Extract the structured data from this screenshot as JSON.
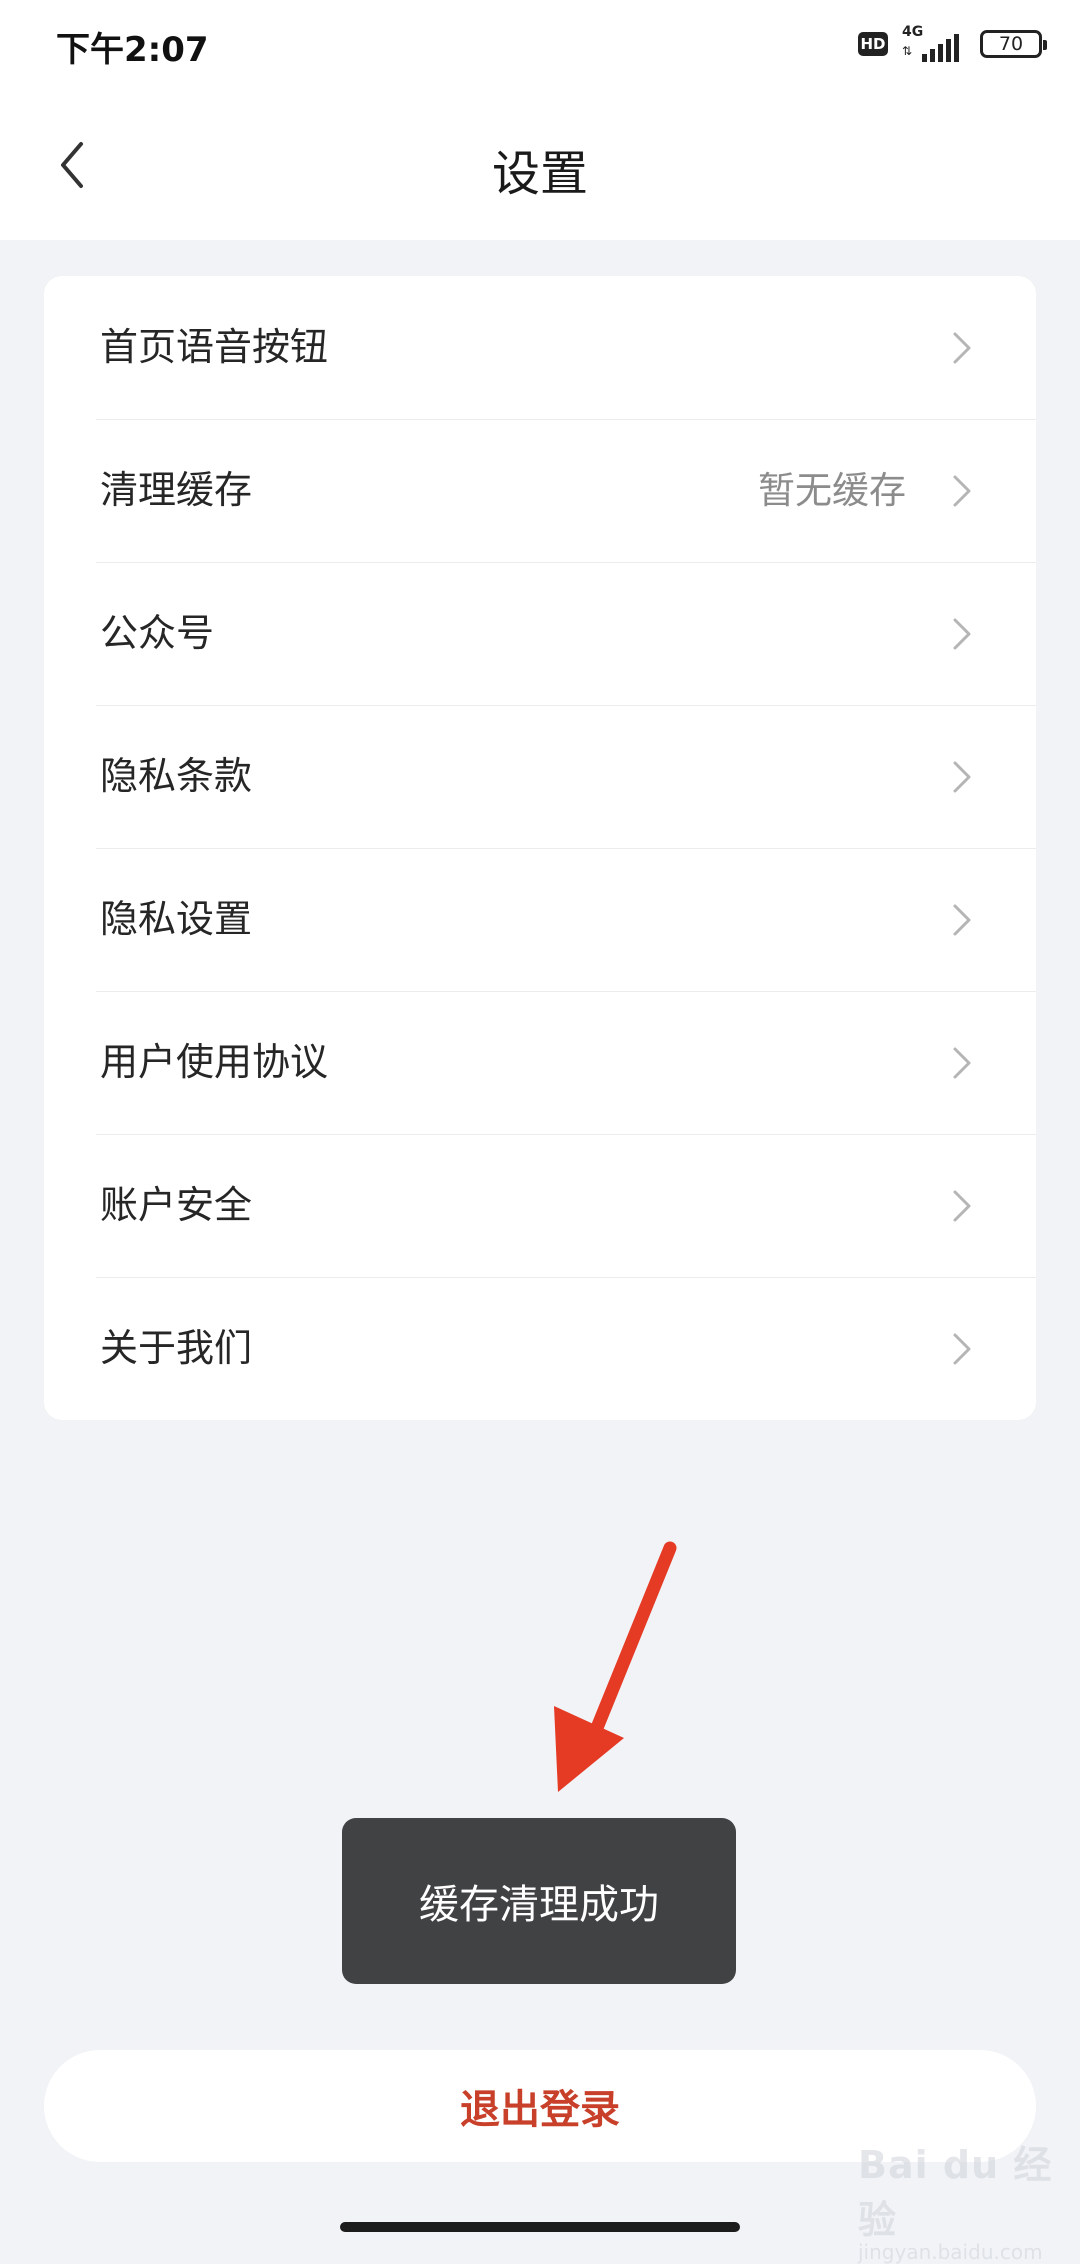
{
  "status_bar": {
    "time": "下午2:07",
    "hd_label": "HD",
    "network_label": "4G",
    "network_arrows": "⇅",
    "battery": "70"
  },
  "nav": {
    "title": "设置",
    "back_icon": "chevron-left-icon"
  },
  "settings": {
    "items": [
      {
        "label": "首页语音按钮",
        "value": ""
      },
      {
        "label": "清理缓存",
        "value": "暂无缓存"
      },
      {
        "label": "公众号",
        "value": ""
      },
      {
        "label": "隐私条款",
        "value": ""
      },
      {
        "label": "隐私设置",
        "value": ""
      },
      {
        "label": "用户使用协议",
        "value": ""
      },
      {
        "label": "账户安全",
        "value": ""
      },
      {
        "label": "关于我们",
        "value": ""
      }
    ],
    "chevron_icon": "chevron-right-icon"
  },
  "toast": {
    "message": "缓存清理成功"
  },
  "logout": {
    "label": "退出登录"
  },
  "watermark": {
    "main": "Bai du 经验",
    "sub": "jingyan.baidu.com"
  },
  "colors": {
    "background": "#f1f3f7",
    "logout_text": "#c8402a",
    "toast_bg": "#404244",
    "annotation_arrow": "#e53a24"
  }
}
